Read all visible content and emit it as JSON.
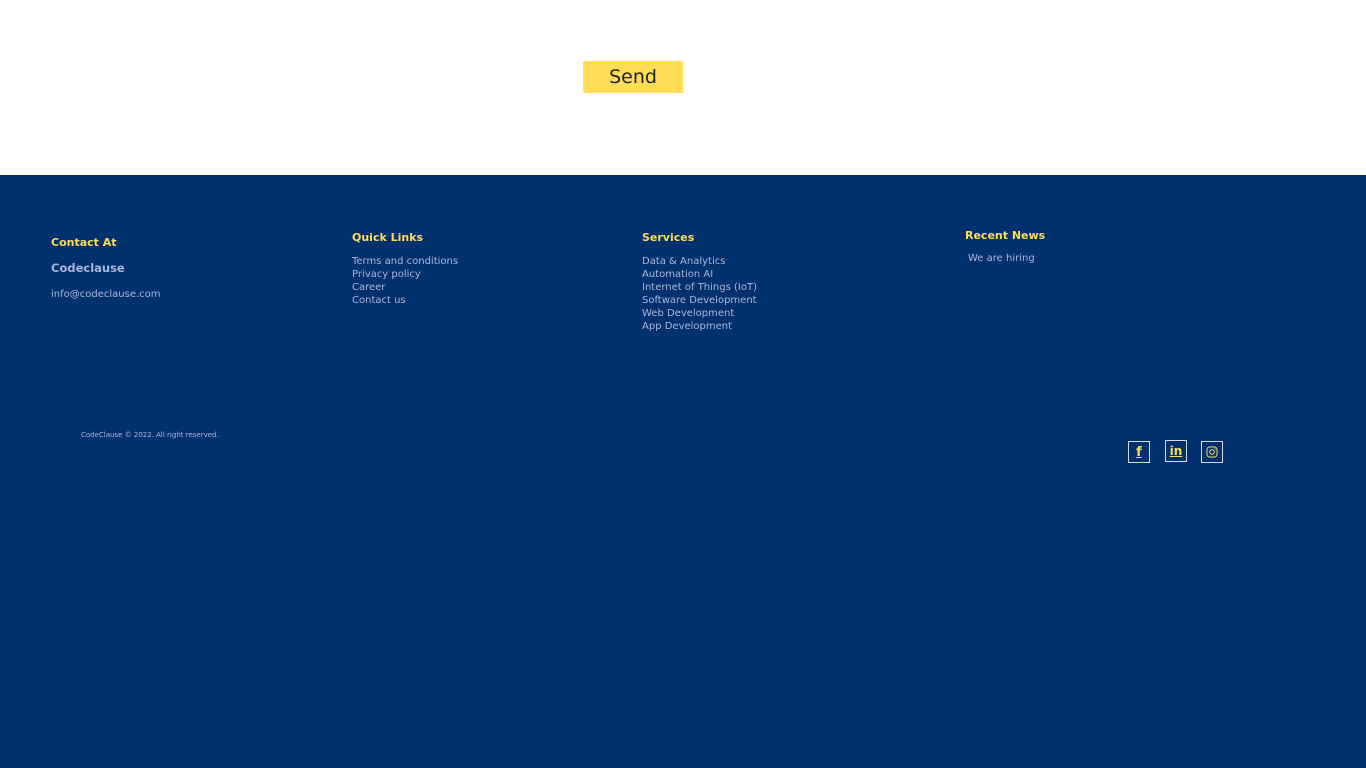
{
  "form": {
    "send_label": "Send"
  },
  "footer": {
    "contact": {
      "heading": "Contact At",
      "brand": "Codeclause",
      "email": "info@codeclause.com"
    },
    "quick_links": {
      "heading": "Quick Links",
      "items": [
        "Terms and conditions",
        "Privacy policy",
        "Career",
        "Contact us"
      ]
    },
    "services": {
      "heading": "Services",
      "items": [
        "Data & Analytics",
        "Automation AI",
        "Internet of Things (IoT)",
        "Software Development",
        "Web Development",
        "App Development"
      ]
    },
    "news": {
      "heading": "Recent News",
      "items": [
        "We are hiring"
      ]
    },
    "copyright": "CodeClause © 2022. All right reserved.",
    "social": [
      {
        "icon": "facebook-icon",
        "glyph": "f"
      },
      {
        "icon": "linkedin-icon",
        "glyph": "in"
      },
      {
        "icon": "instagram-icon"
      }
    ],
    "colors": {
      "background": "#01306f",
      "accent": "#ffdd57",
      "text": "#a9b8d8"
    }
  }
}
